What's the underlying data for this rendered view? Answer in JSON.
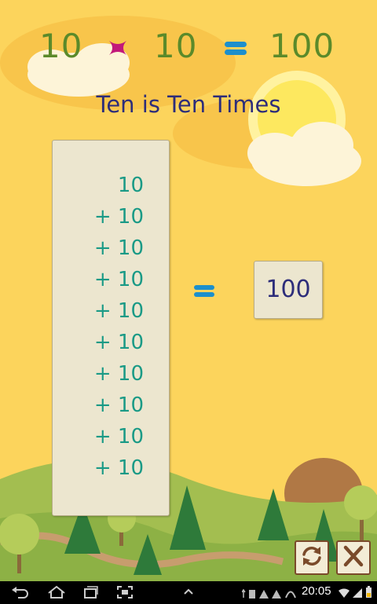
{
  "equation": {
    "operand_a": "10",
    "operand_b": "10",
    "result": "100",
    "times_icon": "times-icon",
    "equals_icon": "equals-icon"
  },
  "title": "Ten is Ten Times",
  "sum": {
    "lines": [
      "10",
      "+ 10",
      "+ 10",
      "+ 10",
      "+ 10",
      "+ 10",
      "+ 10",
      "+ 10",
      "+ 10",
      "+ 10"
    ]
  },
  "answer": "100",
  "controls": {
    "refresh_icon": "refresh-icon",
    "close_icon": "close-icon"
  },
  "status_bar": {
    "time": "20:05"
  },
  "colors": {
    "background": "#fcd45c",
    "number_green": "#5b8a2a",
    "title_navy": "#2d2d7a",
    "sum_teal": "#1a9a86",
    "times_magenta": "#c2197a",
    "equals_blue": "#1c8fcc"
  }
}
